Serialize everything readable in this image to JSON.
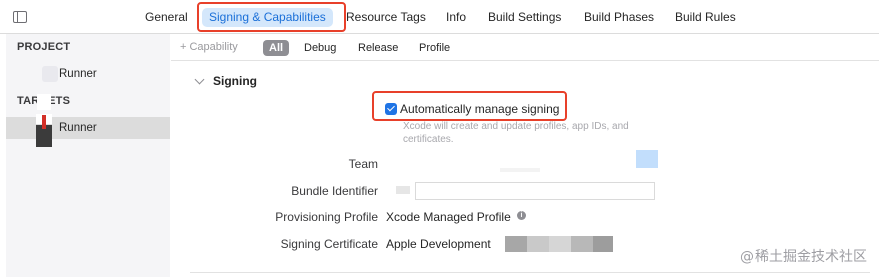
{
  "tabs": [
    {
      "label": "General"
    },
    {
      "label": "Signing & Capabilities",
      "active": true
    },
    {
      "label": "Resource Tags"
    },
    {
      "label": "Info"
    },
    {
      "label": "Build Settings"
    },
    {
      "label": "Build Phases"
    },
    {
      "label": "Build Rules"
    }
  ],
  "navigator": {
    "project_header": "PROJECT",
    "project_item": "Runner",
    "targets_header": "TARGETS",
    "target_item": "Runner"
  },
  "filterbar": {
    "add_capability": "+ Capability",
    "filters": [
      "All",
      "Debug",
      "Release",
      "Profile"
    ],
    "active_filter": "All"
  },
  "signing": {
    "section_title": "Signing",
    "auto_manage_label": "Automatically manage signing",
    "auto_manage_checked": true,
    "help_text": "Xcode will create and update profiles, app IDs, and certificates.",
    "team_label": "Team",
    "bundle_label": "Bundle Identifier",
    "profile_label": "Provisioning Profile",
    "profile_value": "Xcode Managed Profile",
    "cert_label": "Signing Certificate",
    "cert_value": "Apple Development"
  },
  "watermark": "稀土掘金技术社区",
  "colors": {
    "accent": "#1f74e5",
    "active_tab_bg": "#d4e7fb",
    "highlight_box": "#e8402a"
  }
}
